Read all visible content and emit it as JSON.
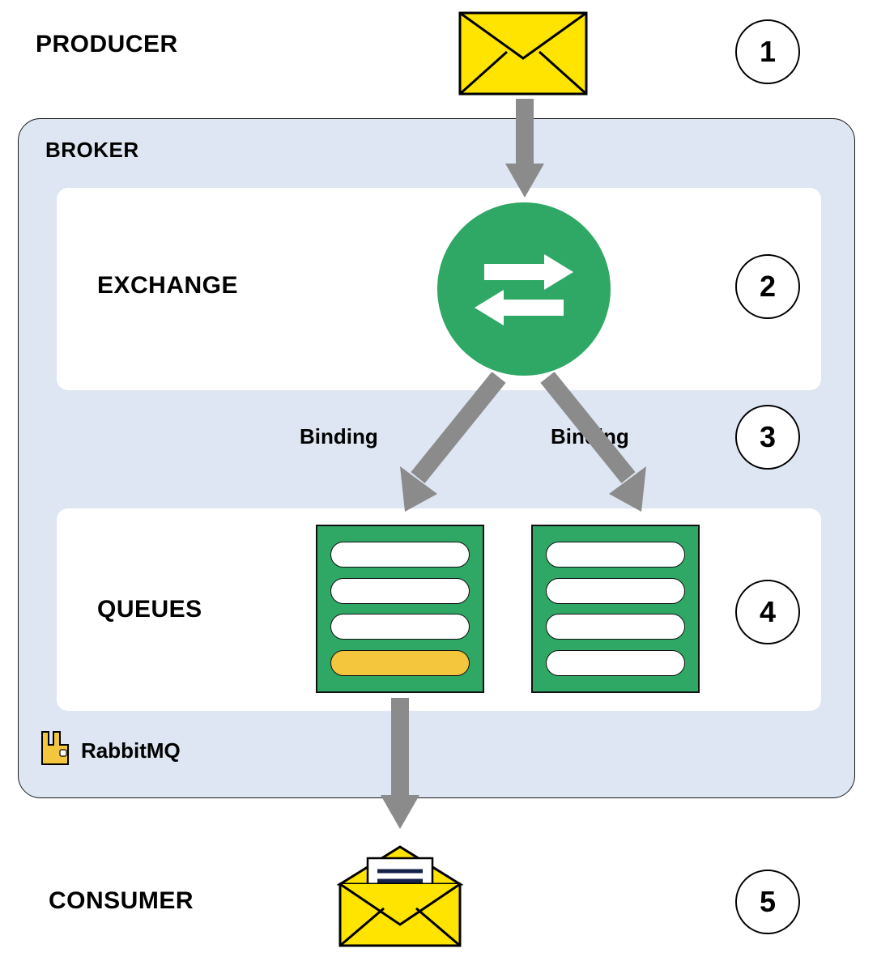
{
  "labels": {
    "producer": "PRODUCER",
    "broker": "BROKER",
    "exchange": "EXCHANGE",
    "queues": "QUEUES",
    "consumer": "CONSUMER",
    "binding_left": "Binding",
    "binding_right": "Binding",
    "rabbitmq": "RabbitMQ"
  },
  "steps": {
    "s1": "1",
    "s2": "2",
    "s3": "3",
    "s4": "4",
    "s5": "5"
  },
  "colors": {
    "broker_bg": "#dde6f2",
    "accent_green": "#2fa866",
    "accent_yellow": "#f4c63d",
    "arrow": "#8b8b8b"
  }
}
